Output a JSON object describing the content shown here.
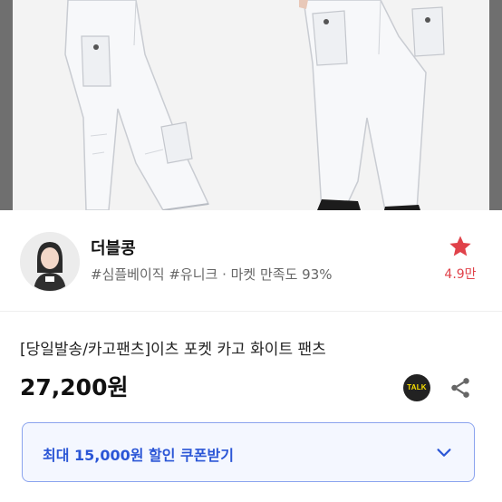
{
  "seller": {
    "name": "더블콩",
    "tags": "#심플베이직 #유니크 · 마켓 만족도 93%",
    "favorite_count": "4.9만"
  },
  "product": {
    "title": "[당일발송/카고팬츠]이츠 포켓 카고 화이트 팬츠",
    "price": "27,200원"
  },
  "actions": {
    "talk_label": "TALK"
  },
  "coupon": {
    "label": "최대 15,000원 할인 쿠폰받기"
  },
  "colors": {
    "favorite": "#e0424a",
    "coupon_text": "#2b56d6",
    "coupon_border": "#8aa3ee",
    "talk_bg": "#222222",
    "talk_text": "#f9e000"
  },
  "icons": {
    "favorite": "star-icon",
    "talk": "kakaotalk-icon",
    "share": "share-icon",
    "coupon_expand": "chevron-down-icon"
  }
}
